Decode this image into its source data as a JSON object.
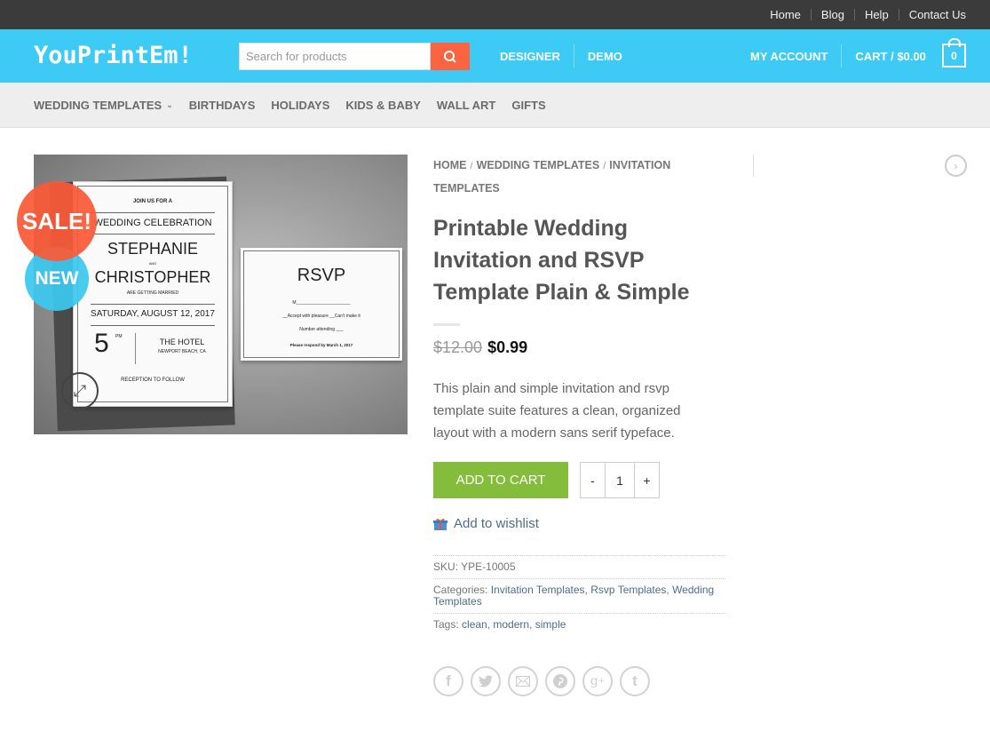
{
  "topbar": {
    "links": [
      "Home",
      "Blog",
      "Help",
      "Contact Us"
    ]
  },
  "header": {
    "logo": "YouPrintEm!",
    "search": {
      "placeholder": "Search for products",
      "value": ""
    },
    "nav_left": [
      "DESIGNER",
      "DEMO"
    ],
    "account": "MY ACCOUNT",
    "cart_label": "CART / $0.00",
    "cart_count": "0",
    "accent_color": "#3dcbf6",
    "search_button_color": "#fb6441"
  },
  "catnav": {
    "items": [
      "WEDDING TEMPLATES",
      "BIRTHDAYS",
      "HOLIDAYS",
      "KIDS & BABY",
      "WALL ART",
      "GIFTS"
    ]
  },
  "gallery": {
    "badges": {
      "sale": "SALE!",
      "new": "NEW"
    },
    "invite": {
      "join": "JOIN US FOR A",
      "event": "WEDDING CELEBRATION",
      "name1": "STEPHANIE",
      "and": "AND",
      "name2": "CHRISTOPHER",
      "married": "ARE GETTING MARRIED",
      "date": "SATURDAY, AUGUST 12, 2017",
      "time": "5",
      "pm": "PM",
      "venue": "THE HOTEL",
      "city": "NEWPORT BEACH, CA",
      "reception": "RECEPTION TO FOLLOW"
    },
    "rsvp": {
      "title": "RSVP",
      "m": "M______________________",
      "options": "__Accept with pleasure    __Can't make it",
      "attending": "Number attending ___",
      "respond": "Please respond by March 1, 2017"
    }
  },
  "product": {
    "breadcrumb": [
      "HOME",
      "WEDDING TEMPLATES",
      "INVITATION TEMPLATES"
    ],
    "title": "Printable Wedding Invitation and RSVP Template Plain & Simple",
    "price_old": "$12.00",
    "price_new": "$0.99",
    "description": "This plain and simple invitation and rsvp template suite features a clean, organized layout with a modern sans serif typeface.",
    "add_to_cart": "ADD TO CART",
    "qty_minus": "-",
    "qty_value": "1",
    "qty_plus": "+",
    "wishlist": "Add to wishlist",
    "sku_label": "SKU:",
    "sku": "YPE-10005",
    "categories_label": "Categories:",
    "categories": [
      "Invitation Templates",
      "Rsvp Templates",
      "Wedding Templates"
    ],
    "tags_label": "Tags:",
    "tags": [
      "clean",
      "modern",
      "simple"
    ],
    "share_icons": [
      "facebook",
      "twitter",
      "email",
      "pinterest",
      "google-plus",
      "tumblr"
    ]
  }
}
